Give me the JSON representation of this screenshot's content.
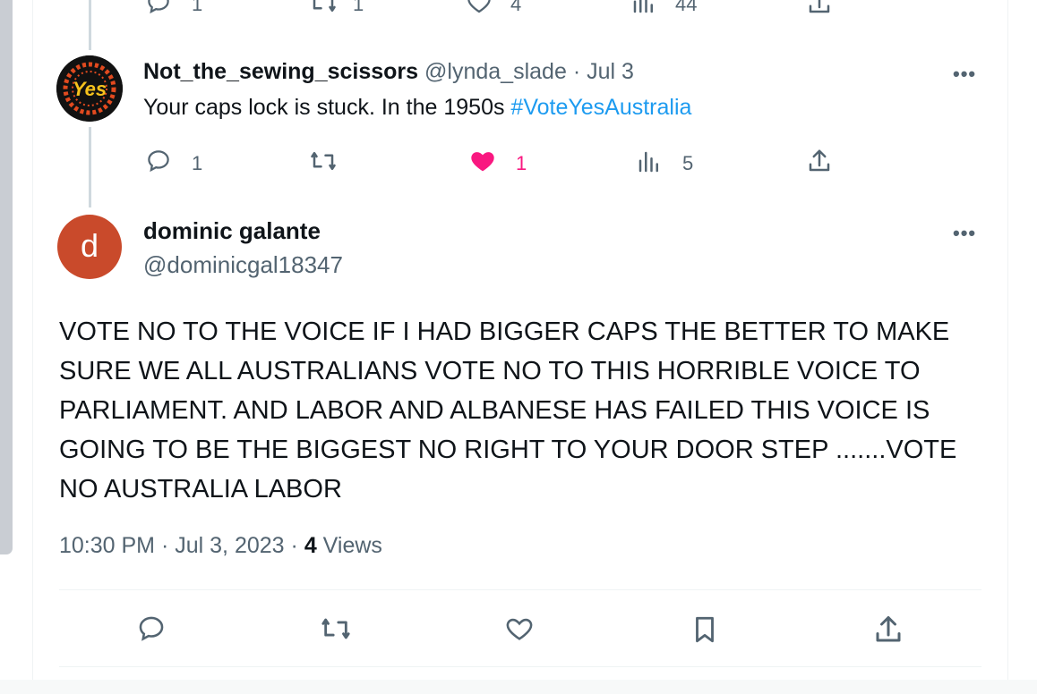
{
  "top_tweet_actions": {
    "reply_count": "1",
    "retweet_count": "1",
    "like_count": "4",
    "views_count": "44"
  },
  "reply_tweet": {
    "avatar_text": "Yes",
    "author_name": "Not_the_sewing_scissors",
    "handle": "@lynda_slade",
    "separator": "·",
    "date": "Jul 3",
    "text": "Your caps lock is stuck. In the 1950s",
    "hashtag": "#VoteYesAustralia",
    "reply_count": "1",
    "like_count": "1",
    "views_count": "5",
    "more_label": "•••"
  },
  "main_tweet": {
    "avatar_letter": "d",
    "author_name": "dominic galante",
    "handle": "@dominicgal18347",
    "more_label": "•••",
    "text": "VOTE NO TO THE VOICE IF I HAD BIGGER CAPS THE BETTER TO MAKE SURE WE ALL AUSTRALIANS VOTE NO TO THIS HORRIBLE VOICE TO PARLIAMENT.  AND LABOR AND ALBANESE HAS FAILED THIS VOICE IS GOING TO BE THE BIGGEST NO RIGHT TO YOUR DOOR STEP .......VOTE NO AUSTRALIA LABOR",
    "time": "10:30 PM",
    "date": "Jul 3, 2023",
    "separator1": "·",
    "separator2": "·",
    "views_count": "4",
    "views_label": "Views"
  },
  "icons": [
    "reply-icon",
    "retweet-icon",
    "like-icon",
    "views-icon",
    "share-icon",
    "bookmark-icon"
  ],
  "colors": {
    "like_active": "#f91880",
    "hashtag": "#1d9bf0",
    "muted": "#536471",
    "avatar_d": "#c94a2b"
  }
}
